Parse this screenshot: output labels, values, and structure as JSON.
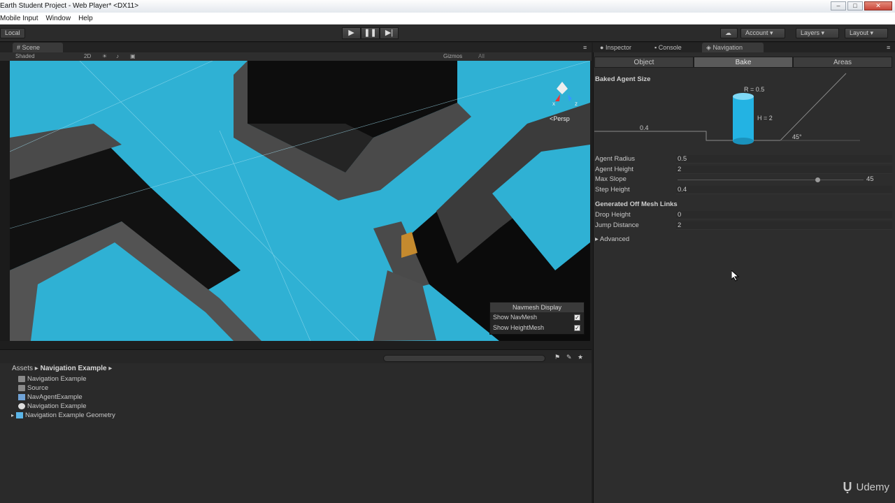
{
  "window": {
    "title": "Earth Student Project - Web Player* <DX11>"
  },
  "menu": [
    "Mobile Input",
    "Window",
    "Help"
  ],
  "toolbar": {
    "local_label": "Local",
    "account_label": "Account",
    "layers_label": "Layers",
    "layout_label": "Layout"
  },
  "scene": {
    "tab_label": "Scene",
    "shaded_label": "Shaded",
    "mode_2d": "2D",
    "gizmos_label": "Gizmos",
    "search_all": "All",
    "persp_label": "Persp",
    "axis_x": "x",
    "axis_z": "z",
    "navmesh_display": {
      "title": "Navmesh Display",
      "show_navmesh": "Show NavMesh",
      "show_heightmesh": "Show HeightMesh"
    }
  },
  "project": {
    "breadcrumb_root": "Assets",
    "breadcrumb_current": "Navigation Example",
    "items": [
      {
        "label": "Navigation Example",
        "icon": "folder-icon"
      },
      {
        "label": "Source",
        "icon": "folder-icon"
      },
      {
        "label": "NavAgentExample",
        "icon": "script-icon"
      },
      {
        "label": "Navigation Example",
        "icon": "unity-scene-icon"
      },
      {
        "label": "Navigation Example Geometry",
        "icon": "prefab-icon"
      }
    ]
  },
  "right_panel": {
    "tabs": [
      "Inspector",
      "Console",
      "Navigation"
    ],
    "segments": [
      "Object",
      "Bake",
      "Areas"
    ],
    "baked_agent_size": "Baked Agent Size",
    "diagram": {
      "r_label": "R = 0.5",
      "h_label": "H = 2",
      "step_label": "0.4",
      "slope_label": "45°"
    },
    "props": [
      {
        "label": "Agent Radius",
        "value": "0.5"
      },
      {
        "label": "Agent Height",
        "value": "2"
      },
      {
        "label": "Max Slope",
        "value": "45"
      },
      {
        "label": "Step Height",
        "value": "0.4"
      }
    ],
    "generated_title": "Generated Off Mesh Links",
    "links": [
      {
        "label": "Drop Height",
        "value": "0"
      },
      {
        "label": "Jump Distance",
        "value": "2"
      }
    ],
    "advanced_label": "Advanced",
    "max_slope_fraction": 0.75
  },
  "watermark": "Udemy"
}
